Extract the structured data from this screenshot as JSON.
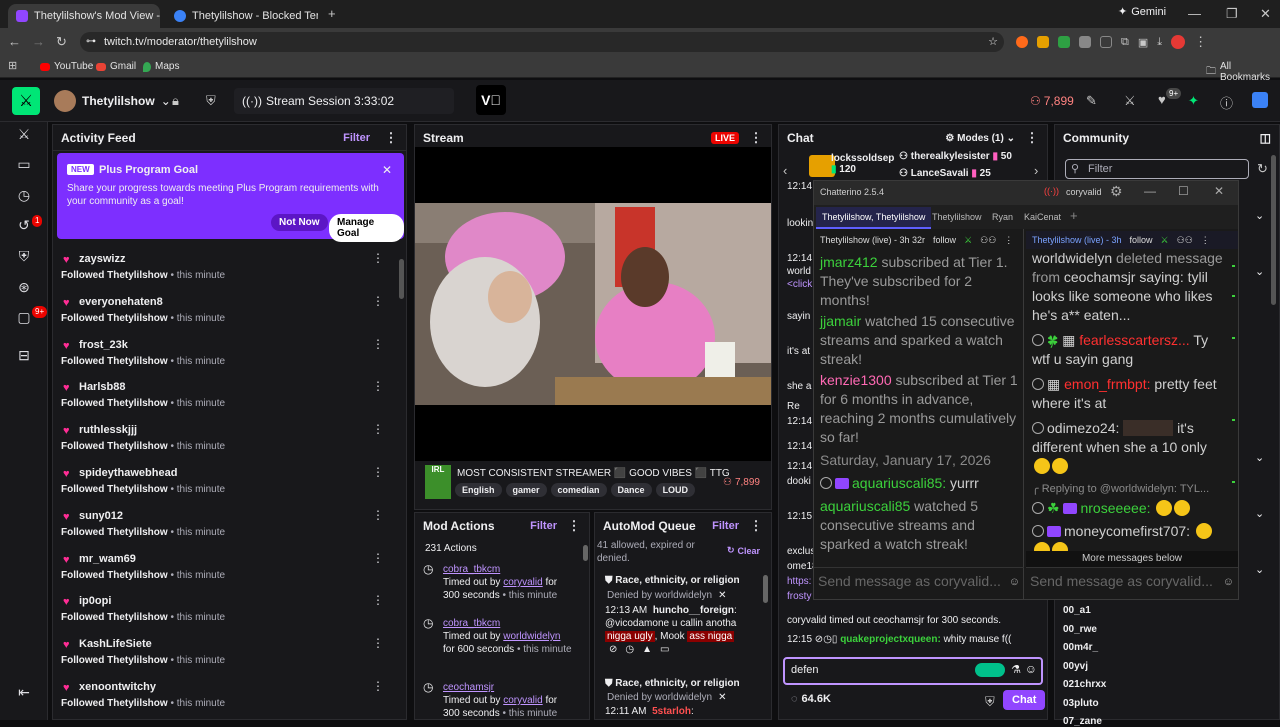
{
  "browser": {
    "tabs": [
      {
        "title": "Thetylilshow's Mod View - ",
        "close": "×"
      },
      {
        "title": "Thetylilshow - Blocked Terms",
        "close": "×"
      }
    ],
    "new_tab": "+",
    "gemini": "Gemini",
    "url": "twitch.tv/moderator/thetylilshow",
    "bookmarks": [
      "YouTube",
      "Gmail",
      "Maps"
    ],
    "all_bookmarks": "All Bookmarks"
  },
  "topbar": {
    "channel": "Thetylilshow",
    "session": "Stream Session 3:33:02",
    "viewers": "7,899",
    "notif_badge": "9+"
  },
  "rail": {
    "badge1": "1",
    "badge2": "9+"
  },
  "activity": {
    "title": "Activity Feed",
    "filter": "Filter",
    "goal": {
      "tag": "NEW",
      "title": "Plus Program Goal",
      "body": "Share your progress towards meeting Plus Program requirements with your community as a goal!",
      "not_now": "Not Now",
      "manage": "Manage Goal"
    },
    "items": [
      {
        "name": "zayswizz",
        "action": "Followed Thetylilshow",
        "time": " • this minute"
      },
      {
        "name": "everyonehaten8",
        "action": "Followed Thetylilshow",
        "time": " • this minute"
      },
      {
        "name": "frost_23k",
        "action": "Followed Thetylilshow",
        "time": " • this minute"
      },
      {
        "name": "Harlsb88",
        "action": "Followed Thetylilshow",
        "time": " • this minute"
      },
      {
        "name": "ruthlesskjjj",
        "action": "Followed Thetylilshow",
        "time": " • this minute"
      },
      {
        "name": "spideythawebhead",
        "action": "Followed Thetylilshow",
        "time": " • this minute"
      },
      {
        "name": "suny012",
        "action": "Followed Thetylilshow",
        "time": " • this minute"
      },
      {
        "name": "mr_wam69",
        "action": "Followed Thetylilshow",
        "time": " • this minute"
      },
      {
        "name": "ip0opi",
        "action": "Followed Thetylilshow",
        "time": " • this minute"
      },
      {
        "name": "KashLifeSiete",
        "action": "Followed Thetylilshow",
        "time": " • this minute"
      },
      {
        "name": "xenoontwitchy",
        "action": "Followed Thetylilshow",
        "time": " • this minute"
      }
    ]
  },
  "stream": {
    "title": "Stream",
    "live": "LIVE",
    "stream_title": "MOST CONSISTENT STREAMER ⬛ GOOD VIBES ⬛ TTG",
    "tags": [
      "English",
      "gamer",
      "comedian",
      "Dance",
      "LOUD"
    ],
    "viewers": "7,899",
    "thumb": "IRL"
  },
  "modactions": {
    "title": "Mod Actions",
    "filter": "Filter",
    "count": "231 Actions",
    "items": [
      {
        "user": "cobra_tbkcm",
        "l1": "Timed out by ",
        "by": "coryvalid",
        "l2": " for",
        "l3": "300 seconds",
        "l4": " • this minute"
      },
      {
        "user": "cobra_tbkcm",
        "l1": "Timed out by ",
        "by": "worldwidelyn",
        "l2": "",
        "l3": "for 600 seconds",
        "l4": " • this minute"
      },
      {
        "user": "ceochamsjr",
        "l1": "Timed out by ",
        "by": "coryvalid",
        "l2": " for",
        "l3": "300 seconds",
        "l4": " • this minute"
      }
    ]
  },
  "automod": {
    "title": "AutoMod Queue",
    "filter": "Filter",
    "summary": "41 allowed, expired or denied.",
    "clear": "Clear",
    "items": [
      {
        "cat": "Race, ethnicity, or religion",
        "denied": "Denied by worldwidelyn",
        "time": "12:13 AM",
        "user": "huncho__foreign",
        "msg1": "@vicodamone u callin anotha",
        "bad1": "nigga ugly",
        "mid": ", Mook",
        "bad2": "ass nigga"
      },
      {
        "cat": "Race, ethnicity, or religion",
        "denied": "Denied by worldwidelyn",
        "time": "12:11 AM",
        "user": "5starloh"
      }
    ]
  },
  "chat": {
    "title": "Chat",
    "modes": "Modes (1)",
    "gifters": [
      {
        "name": "lockssoldsep",
        "count": "120"
      },
      {
        "name": "therealkylesister",
        "count": "50"
      },
      {
        "name": "LanceSavali",
        "count": "25"
      }
    ],
    "lines": [
      "12:14",
      "lookin",
      "12:14",
      "world",
      "<click",
      "sayin",
      "it's at",
      "she a",
      "Re",
      "12:14",
      "12:14",
      "12:14",
      "dooki",
      "12:15",
      "exclus",
      "ome18",
      "https:",
      "frosty"
    ],
    "timeout": "coryvalid timed out ceochamsjr for 300 seconds.",
    "last_time": "12:15",
    "last_user": "quakeprojectxqueen:",
    "last_msg": "whity mause f((",
    "input": "defen",
    "viewers": "64.6K",
    "send": "Chat"
  },
  "chatterino": {
    "title": "Chatterino 2.5.4",
    "account": "coryvalid",
    "tabs": [
      "Thetylilshow, Thetylilshow",
      "Thetylilshow",
      "Ryan",
      "KaiCenat"
    ],
    "left": {
      "header": "Thetylilshow (live) - 3h 32r",
      "follow": "follow",
      "msgs": [
        {
          "user": "jmarz412",
          "text": " subscribed at Tier 1. They've subscribed for 2 months!"
        },
        {
          "user": "jjamair",
          "text": " watched 15 consecutive streams and sparked a watch streak!"
        },
        {
          "user": "kenzie1300",
          "text": " subscribed at Tier 1 for 6 months in advance, reaching 2 months cumulatively so far!"
        }
      ],
      "date": "Saturday, January 17, 2026",
      "m4user": "aquariuscali85:",
      "m4text": " yurrr",
      "m5user": "aquariuscali85",
      "m5text": " watched 5 consecutive streams and sparked a watch streak!",
      "input": "Send message as coryvalid..."
    },
    "right": {
      "header": "Thetylilshow (live) - 3h",
      "follow": "follow",
      "del_user": "worldwidelyn",
      "del_text": " deleted message from ",
      "del_target": "ceochamsjr",
      "del_text2": " saying: tylil looks like someone who likes he's a** eaten...",
      "m1user": "fearlesscartersz...",
      "m1text": " Ty wtf u sayin gang",
      "m2user": "emon_frmbpt:",
      "m2text": " pretty feet where it's at",
      "m3user": "odimezo24:",
      "m3text": " it's different when she a 10 only",
      "reply": "Replying to @worldwidelyn: TYL...",
      "m4user": "nroseeeee:",
      "m5user": "moneycomefirst707:",
      "more": "More messages below",
      "input": "Send message as coryvalid..."
    }
  },
  "community": {
    "title": "Community",
    "filter_placeholder": "Filter",
    "users": [
      "00_a1",
      "00_rwe",
      "00m4r_",
      "00yvj",
      "021chrxx",
      "03pluto",
      "07_zane"
    ]
  }
}
